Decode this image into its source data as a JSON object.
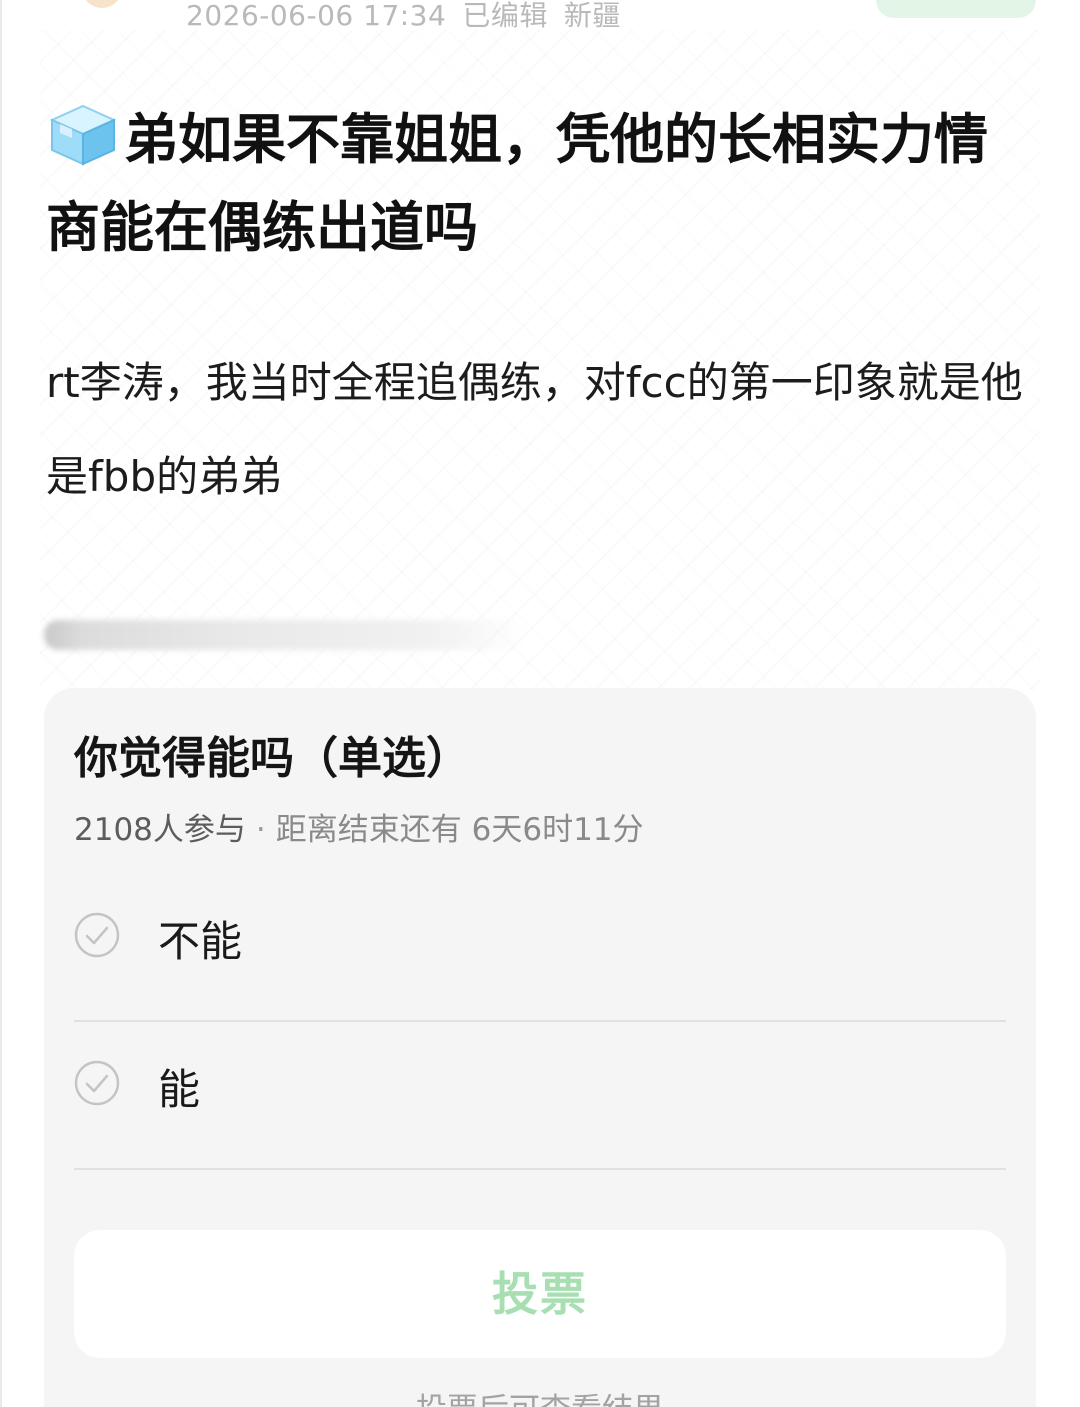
{
  "post": {
    "timestamp": "2026-06-06 17:34",
    "edited": "已编辑",
    "location": "新疆",
    "title": "弟如果不靠姐姐，凭他的长相实力情商能在偶练出道吗",
    "title_icon": "ice-cube-icon",
    "body": "rt李涛，我当时全程追偶练，对fcc的第一印象就是他是fbb的弟弟"
  },
  "poll": {
    "title": "你觉得能吗（单选）",
    "participants": "2108人参与",
    "separator": "·",
    "remaining": "距离结束还有 6天6时11分",
    "options": [
      {
        "label": "不能"
      },
      {
        "label": "能"
      }
    ],
    "vote_label": "投票",
    "hint": "投票后可查看结果"
  },
  "colors": {
    "accent_green": "#a8dfb2",
    "follow_bg": "#e3f5e6",
    "card_bg": "#f5f5f5"
  }
}
